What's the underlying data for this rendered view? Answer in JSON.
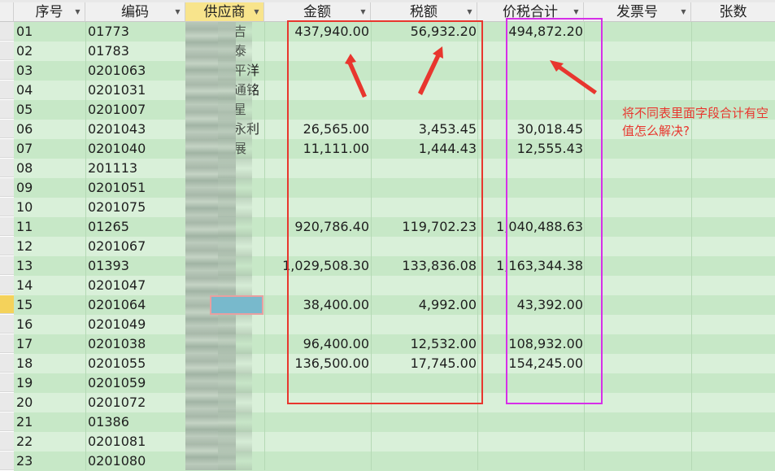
{
  "headers": {
    "seq": "序号",
    "code": "编码",
    "supplier": "供应商",
    "amount": "金额",
    "tax": "税额",
    "total": "价税合计",
    "invoice": "发票号",
    "count": "张数"
  },
  "rows": [
    {
      "seq": "01",
      "code": "01773",
      "supplier": "吉",
      "amount": "437,940.00",
      "tax": "56,932.20",
      "total": "494,872.20"
    },
    {
      "seq": "02",
      "code": "01783",
      "supplier": "泰",
      "amount": "",
      "tax": "",
      "total": ""
    },
    {
      "seq": "03",
      "code": "0201063",
      "supplier": "平洋",
      "amount": "",
      "tax": "",
      "total": ""
    },
    {
      "seq": "04",
      "code": "0201031",
      "supplier": "通铭",
      "amount": "",
      "tax": "",
      "total": ""
    },
    {
      "seq": "05",
      "code": "0201007",
      "supplier": "星",
      "amount": "",
      "tax": "",
      "total": ""
    },
    {
      "seq": "06",
      "code": "0201043",
      "supplier": "永利",
      "amount": "26,565.00",
      "tax": "3,453.45",
      "total": "30,018.45"
    },
    {
      "seq": "07",
      "code": "0201040",
      "supplier": "展",
      "amount": "11,111.00",
      "tax": "1,444.43",
      "total": "12,555.43"
    },
    {
      "seq": "08",
      "code": "201113",
      "supplier": "",
      "amount": "",
      "tax": "",
      "total": ""
    },
    {
      "seq": "09",
      "code": "0201051",
      "supplier": "",
      "amount": "",
      "tax": "",
      "total": ""
    },
    {
      "seq": "10",
      "code": "0201075",
      "supplier": "",
      "amount": "",
      "tax": "",
      "total": ""
    },
    {
      "seq": "11",
      "code": "01265",
      "supplier": "",
      "amount": "920,786.40",
      "tax": "119,702.23",
      "total": "1,040,488.63"
    },
    {
      "seq": "12",
      "code": "0201067",
      "supplier": "",
      "amount": "",
      "tax": "",
      "total": ""
    },
    {
      "seq": "13",
      "code": "01393",
      "supplier": "",
      "amount": "1,029,508.30",
      "tax": "133,836.08",
      "total": "1,163,344.38"
    },
    {
      "seq": "14",
      "code": "0201047",
      "supplier": "",
      "amount": "",
      "tax": "",
      "total": ""
    },
    {
      "seq": "15",
      "code": "0201064",
      "supplier": "",
      "amount": "38,400.00",
      "tax": "4,992.00",
      "total": "43,392.00"
    },
    {
      "seq": "16",
      "code": "0201049",
      "supplier": "",
      "amount": "",
      "tax": "",
      "total": ""
    },
    {
      "seq": "17",
      "code": "0201038",
      "supplier": "",
      "amount": "96,400.00",
      "tax": "12,532.00",
      "total": "108,932.00"
    },
    {
      "seq": "18",
      "code": "0201055",
      "supplier": "",
      "amount": "136,500.00",
      "tax": "17,745.00",
      "total": "154,245.00"
    },
    {
      "seq": "19",
      "code": "0201059",
      "supplier": "",
      "amount": "",
      "tax": "",
      "total": ""
    },
    {
      "seq": "20",
      "code": "0201072",
      "supplier": "",
      "amount": "",
      "tax": "",
      "total": ""
    },
    {
      "seq": "21",
      "code": "01386",
      "supplier": "",
      "amount": "",
      "tax": "",
      "total": ""
    },
    {
      "seq": "22",
      "code": "0201081",
      "supplier": "",
      "amount": "",
      "tax": "",
      "total": ""
    },
    {
      "seq": "23",
      "code": "0201080",
      "supplier": "",
      "amount": "",
      "tax": "",
      "total": ""
    }
  ],
  "annotation": {
    "text": "将不同表里面字段合计有空值怎么解决?",
    "box_color": "#e8362e",
    "total_box_color": "#d62fe8",
    "arrow_color": "#e8362e"
  },
  "colors": {
    "row_a": "#c7e8c7",
    "row_b": "#d9f0d9",
    "selected_header": "#f8e48c",
    "current_row_marker": "#f4d25b"
  },
  "icons": {
    "column_filter": "dropdown-arrow-icon"
  }
}
